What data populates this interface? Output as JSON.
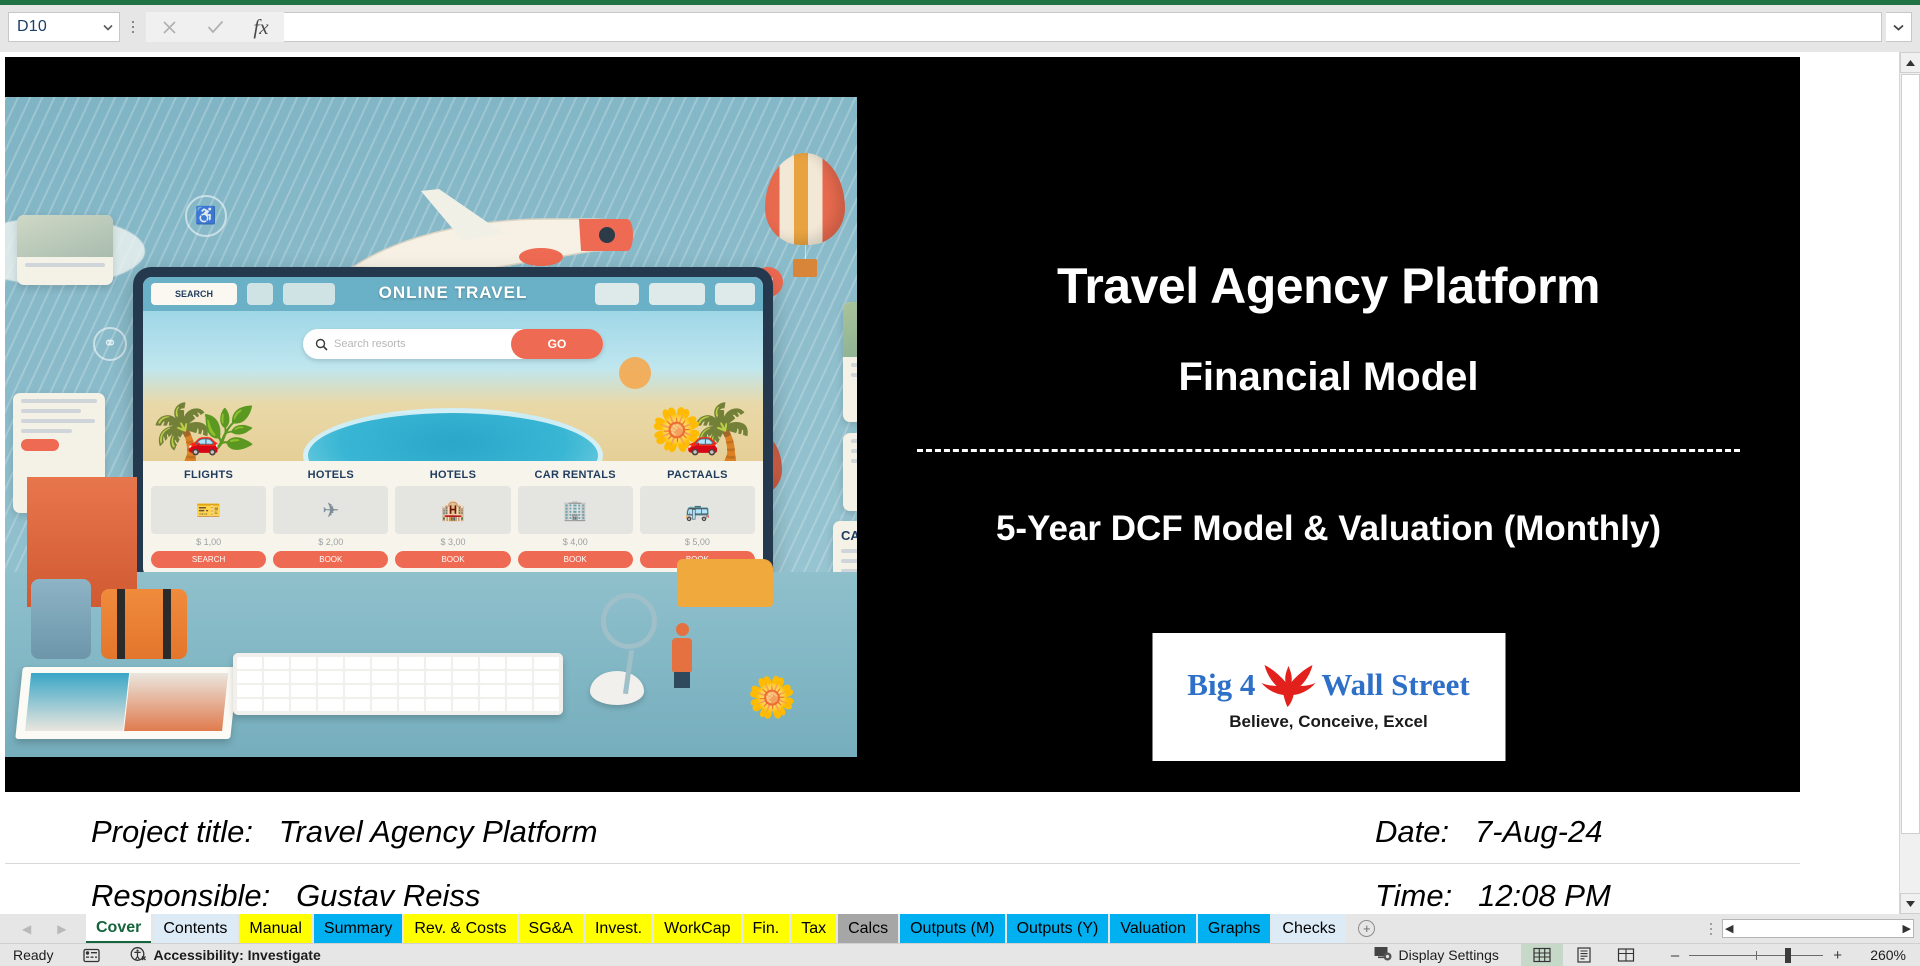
{
  "formula_bar": {
    "name_box_value": "D10",
    "formula_value": "",
    "cancel_icon": "close-icon",
    "confirm_icon": "check-icon",
    "function_icon": "fx-icon",
    "expand_icon": "chevron-down-icon",
    "namebox_caret_icon": "chevron-down-icon"
  },
  "slide": {
    "title": "Travel Agency Platform",
    "subtitle": "Financial Model",
    "divider": "------------------------------------------------------",
    "scope": "5-Year DCF Model & Valuation (Monthly)",
    "logo": {
      "word_left": "Big 4",
      "word_right": "Wall Street",
      "tagline": "Believe, Conceive, Excel",
      "bird_icon": "eagle-icon",
      "accent_color": "#2e6fc7",
      "bird_color": "#e2211c"
    },
    "illustration": {
      "brand": "ONLINE TRAVEL",
      "nav_label": "SEARCH",
      "search_placeholder": "Search resorts",
      "search_button": "GO",
      "categories": [
        {
          "label": "FLIGHTS",
          "price": "$ 1,00",
          "button": "SEARCH",
          "icon": "ticket-icon"
        },
        {
          "label": "HOTELS",
          "price": "$ 2,00",
          "button": "BOOK",
          "icon": "plane-icon"
        },
        {
          "label": "HOTELS",
          "price": "$ 3,00",
          "button": "BOOK",
          "icon": "hotel-icon"
        },
        {
          "label": "CAR RENTALS",
          "price": "$ 4,00",
          "button": "BOOK",
          "icon": "building-icon"
        },
        {
          "label": "PACTAALS",
          "price": "$ 5,00",
          "button": "BOOK",
          "icon": "bus-icon"
        }
      ],
      "side_card_title": "CAR RE",
      "objects": [
        "airplane-icon",
        "hot-air-balloon-icon",
        "suitcase-icon",
        "keyboard-icon",
        "mouse-icon",
        "brochure-icon",
        "palm-tree-icon",
        "flower-icon",
        "magnifier-icon",
        "person-icon"
      ]
    }
  },
  "worksheet_rows": [
    {
      "label": "Project title:",
      "value": "Travel Agency Platform",
      "right_label": "Date:",
      "right_value": "7-Aug-24"
    },
    {
      "label": "Responsible:",
      "value": "Gustav Reiss",
      "right_label": "Time:",
      "right_value": "12:08 PM"
    }
  ],
  "tabs": {
    "prev_icon": "chevron-left-icon",
    "next_icon": "chevron-right-icon",
    "add_label": "+",
    "items": [
      {
        "label": "Cover",
        "color": "active",
        "active": true
      },
      {
        "label": "Contents",
        "color": "lightblue",
        "active": false
      },
      {
        "label": "Manual",
        "color": "yellow",
        "active": false
      },
      {
        "label": "Summary",
        "color": "cyan",
        "active": false
      },
      {
        "label": "Rev. & Costs",
        "color": "yellow",
        "active": false
      },
      {
        "label": "SG&A",
        "color": "yellow",
        "active": false
      },
      {
        "label": "Invest.",
        "color": "yellow",
        "active": false
      },
      {
        "label": "WorkCap",
        "color": "yellow",
        "active": false
      },
      {
        "label": "Fin.",
        "color": "yellow",
        "active": false
      },
      {
        "label": "Tax",
        "color": "yellow",
        "active": false
      },
      {
        "label": "Calcs",
        "color": "gray",
        "active": false
      },
      {
        "label": "Outputs (M)",
        "color": "cyan",
        "active": false
      },
      {
        "label": "Outputs (Y)",
        "color": "cyan",
        "active": false
      },
      {
        "label": "Valuation",
        "color": "cyan",
        "active": false
      },
      {
        "label": "Graphs",
        "color": "cyan",
        "active": false
      },
      {
        "label": "Checks",
        "color": "lightblue",
        "active": false
      }
    ],
    "colors": {
      "yellow": "#ffff00",
      "cyan": "#00b0f0",
      "gray": "#a6a6a6",
      "lightblue": "#ddebf7",
      "active_text": "#15653c"
    }
  },
  "status_bar": {
    "mode": "Ready",
    "macro_icon": "record-macro-icon",
    "accessibility_icon": "accessibility-icon",
    "accessibility_label": "Accessibility: Investigate",
    "display_settings_icon": "display-settings-icon",
    "display_settings_label": "Display Settings",
    "views": [
      {
        "name": "normal-view",
        "icon": "grid-icon",
        "active": true
      },
      {
        "name": "page-layout-view",
        "icon": "page-icon",
        "active": false
      },
      {
        "name": "page-break-view",
        "icon": "pagebreak-icon",
        "active": false
      }
    ],
    "zoom_out_label": "–",
    "zoom_in_label": "+",
    "zoom_level": "260%"
  },
  "scrollbars": {
    "v_up_icon": "triangle-up-icon",
    "v_down_icon": "triangle-down-icon",
    "h_left_icon": "triangle-left-icon",
    "h_right_icon": "triangle-right-icon"
  }
}
